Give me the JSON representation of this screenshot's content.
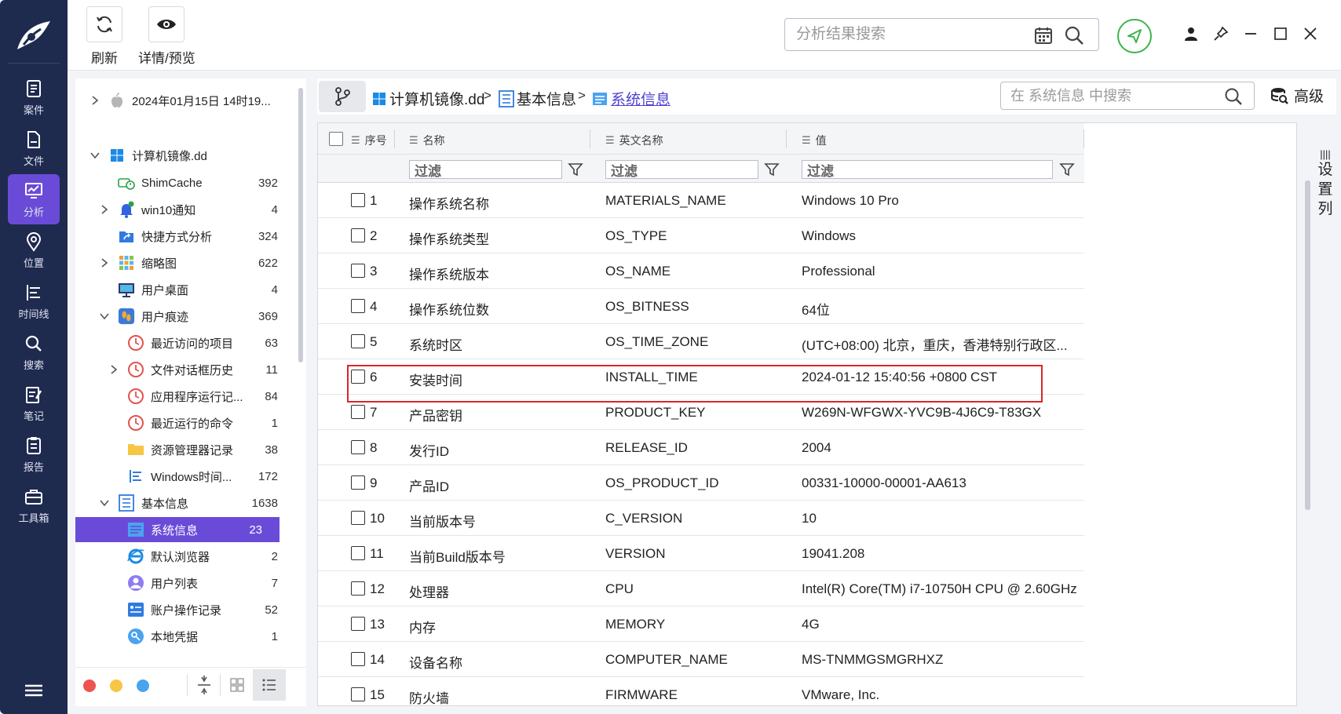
{
  "nav": {
    "items": [
      {
        "label": "案件",
        "icon": "case-icon"
      },
      {
        "label": "文件",
        "icon": "file-icon"
      },
      {
        "label": "分析",
        "icon": "analysis-icon",
        "active": true
      },
      {
        "label": "位置",
        "icon": "location-icon"
      },
      {
        "label": "时间线",
        "icon": "timeline-icon"
      },
      {
        "label": "搜索",
        "icon": "search-icon"
      },
      {
        "label": "笔记",
        "icon": "note-icon"
      },
      {
        "label": "报告",
        "icon": "report-icon"
      },
      {
        "label": "工具箱",
        "icon": "toolbox-icon"
      }
    ]
  },
  "toolbar": {
    "refresh_label": "刷新",
    "preview_label": "详情/预览",
    "search_placeholder": "分析结果搜索"
  },
  "tree": {
    "root_label": "2024年01月15日 14时19...",
    "items": [
      {
        "label": "计算机镜像.dd",
        "count": ""
      },
      {
        "label": "ShimCache",
        "count": "392"
      },
      {
        "label": "win10通知",
        "count": "4"
      },
      {
        "label": "快捷方式分析",
        "count": "324"
      },
      {
        "label": "缩略图",
        "count": "622"
      },
      {
        "label": "用户桌面",
        "count": "4"
      },
      {
        "label": "用户痕迹",
        "count": "369"
      },
      {
        "label": "最近访问的项目",
        "count": "63"
      },
      {
        "label": "文件对话框历史",
        "count": "11"
      },
      {
        "label": "应用程序运行记...",
        "count": "84"
      },
      {
        "label": "最近运行的命令",
        "count": "1"
      },
      {
        "label": "资源管理器记录",
        "count": "38"
      },
      {
        "label": "Windows时间...",
        "count": "172"
      },
      {
        "label": "基本信息",
        "count": "1638"
      },
      {
        "label": "系统信息",
        "count": "23"
      },
      {
        "label": "默认浏览器",
        "count": "2"
      },
      {
        "label": "用户列表",
        "count": "7"
      },
      {
        "label": "账户操作记录",
        "count": "52"
      },
      {
        "label": "本地凭据",
        "count": "1"
      }
    ]
  },
  "breadcrumb": {
    "items": [
      "计算机镜像.dd",
      "基本信息",
      "系统信息"
    ],
    "sep": ">"
  },
  "local_search": {
    "placeholder": "在 系统信息 中搜索"
  },
  "advanced_label": "高级",
  "set_columns_label": [
    "设",
    "置",
    "列"
  ],
  "table": {
    "columns": [
      "序号",
      "名称",
      "英文名称",
      "值"
    ],
    "filter_placeholder": "过滤",
    "rows": [
      {
        "no": "1",
        "name": "操作系统名称",
        "en": "MATERIALS_NAME",
        "value": "Windows 10 Pro"
      },
      {
        "no": "2",
        "name": "操作系统类型",
        "en": "OS_TYPE",
        "value": "Windows"
      },
      {
        "no": "3",
        "name": "操作系统版本",
        "en": "OS_NAME",
        "value": "Professional"
      },
      {
        "no": "4",
        "name": "操作系统位数",
        "en": "OS_BITNESS",
        "value": "64位"
      },
      {
        "no": "5",
        "name": "系统时区",
        "en": "OS_TIME_ZONE",
        "value": "(UTC+08:00) 北京，重庆，香港特别行政区..."
      },
      {
        "no": "6",
        "name": "安装时间",
        "en": "INSTALL_TIME",
        "value": "2024-01-12 15:40:56 +0800 CST"
      },
      {
        "no": "7",
        "name": "产品密钥",
        "en": "PRODUCT_KEY",
        "value": "W269N-WFGWX-YVC9B-4J6C9-T83GX"
      },
      {
        "no": "8",
        "name": "发行ID",
        "en": "RELEASE_ID",
        "value": "2004"
      },
      {
        "no": "9",
        "name": "产品ID",
        "en": "OS_PRODUCT_ID",
        "value": "00331-10000-00001-AA613"
      },
      {
        "no": "10",
        "name": "当前版本号",
        "en": "C_VERSION",
        "value": "10"
      },
      {
        "no": "11",
        "name": "当前Build版本号",
        "en": "VERSION",
        "value": "19041.208"
      },
      {
        "no": "12",
        "name": "处理器",
        "en": "CPU",
        "value": "Intel(R) Core(TM) i7-10750H CPU @ 2.60GHz"
      },
      {
        "no": "13",
        "name": "内存",
        "en": "MEMORY",
        "value": "4G"
      },
      {
        "no": "14",
        "name": "设备名称",
        "en": "COMPUTER_NAME",
        "value": "MS-TNMMGSMGRHXZ"
      },
      {
        "no": "15",
        "name": "防火墙",
        "en": "FIRMWARE",
        "value": "VMware, Inc."
      }
    ]
  },
  "colors": {
    "accent": "#6a4bd8",
    "nav_bg": "#1f2a4f",
    "highlight": "#d9262a",
    "share": "#3cb44b"
  }
}
